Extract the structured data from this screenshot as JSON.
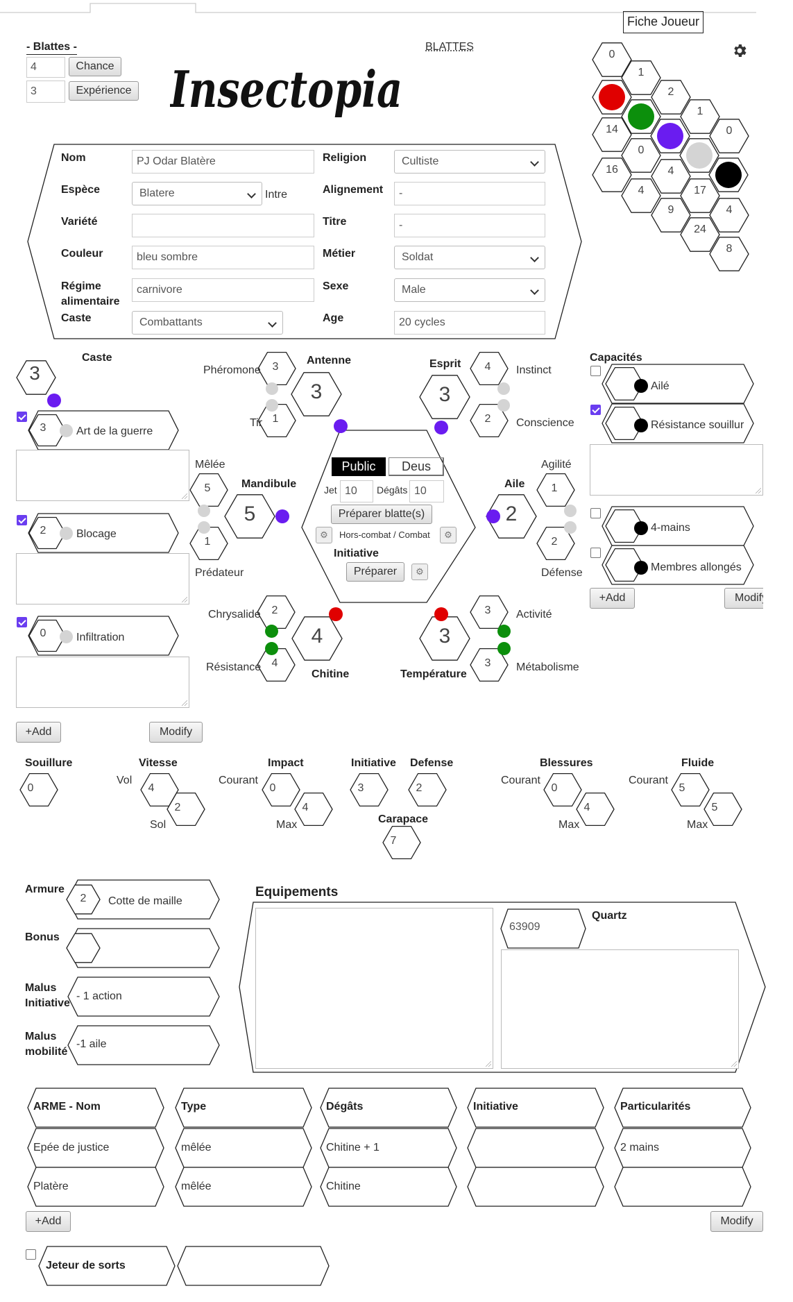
{
  "header": {
    "player_sheet": "Fiche Joueur",
    "blattes_title": "BLATTES",
    "logo_text": "Insectopia",
    "settings_icon": "gear-icon"
  },
  "blattes_box": {
    "title": "- Blattes -",
    "chance_value": "4",
    "chance_label": "Chance",
    "experience_value": "3",
    "experience_label": "Expérience"
  },
  "honeycomb": {
    "numbers": [
      "0",
      "1",
      "2",
      "1",
      "0",
      "14",
      "0",
      "4",
      "17",
      "4",
      "16",
      "4",
      "9",
      "24",
      "8"
    ],
    "dot_colors": {
      "red": "#e00000",
      "green": "#0c8f0c",
      "purple": "#6a1cf0",
      "gray": "#d4d4d4",
      "black": "#000000"
    }
  },
  "identity": {
    "name_label": "Nom",
    "name_value": "PJ Odar Blatère",
    "species_label": "Espèce",
    "species_value": "Blatere",
    "species_suffix": "Intre",
    "variety_label": "Variété",
    "variety_value": "",
    "color_label": "Couleur",
    "color_value": "bleu sombre",
    "diet_label": "Régime alimentaire",
    "diet_value": "carnivore",
    "caste_label": "Caste",
    "caste_value": "Combattants",
    "religion_label": "Religion",
    "religion_value": "Cultiste",
    "alignment_label": "Alignement",
    "alignment_value": "-",
    "title_label": "Titre",
    "title_value": "-",
    "job_label": "Métier",
    "job_value": "Soldat",
    "sex_label": "Sexe",
    "sex_value": "Male",
    "age_label": "Age",
    "age_value": "20 cycles"
  },
  "caste_panel": {
    "label": "Caste",
    "value": "3",
    "skills": [
      {
        "value": "3",
        "name": "Art de la guerre"
      },
      {
        "value": "2",
        "name": "Blocage"
      },
      {
        "value": "0",
        "name": "Infiltration"
      }
    ],
    "add_label": "+Add",
    "modify_label": "Modify"
  },
  "stats": {
    "antenne": {
      "label": "Antenne",
      "value": "3",
      "pheromone_label": "Phéromone",
      "pheromone": "3",
      "tir_label": "Tir",
      "tir": "1"
    },
    "esprit": {
      "label": "Esprit",
      "value": "3",
      "instinct_label": "Instinct",
      "instinct": "4",
      "conscience_label": "Conscience",
      "conscience": "2"
    },
    "mandibule": {
      "label": "Mandibule",
      "value": "5",
      "melee_label": "Mêlée",
      "melee": "5",
      "predateur_label": "Prédateur",
      "predateur": "1"
    },
    "aile": {
      "label": "Aile",
      "value": "2",
      "agilite_label": "Agilité",
      "agilite": "1",
      "defense_label": "Défense",
      "defense": "2"
    },
    "chitine": {
      "label": "Chitine",
      "value": "4",
      "chrysalide_label": "Chrysalide",
      "chrysalide": "2",
      "resistance_label": "Résistance",
      "resistance": "4"
    },
    "temperature": {
      "label": "Température",
      "value": "3",
      "activite_label": "Activité",
      "activite": "3",
      "metabolisme_label": "Métabolisme",
      "metabolisme": "3"
    }
  },
  "center": {
    "tab_public": "Public",
    "tab_deus": "Deus",
    "jet_label": "Jet",
    "jet_value": "10",
    "degats_label": "Dégâts",
    "degats_value": "10",
    "prepare_blattes": "Préparer blatte(s)",
    "combat_label": "Hors-combat / Combat",
    "initiative_label": "Initiative",
    "prepare": "Préparer"
  },
  "capacites": {
    "label": "Capacités",
    "items": [
      {
        "name": "Ailé",
        "checked": false
      },
      {
        "name": "Résistance souillur",
        "checked": true
      },
      {
        "name": "4-mains",
        "checked": false
      },
      {
        "name": "Membres allongés",
        "checked": false
      }
    ],
    "add_label": "+Add",
    "modify_label": "Modify"
  },
  "secondary": {
    "souillure_label": "Souillure",
    "souillure": "0",
    "vitesse_label": "Vitesse",
    "vol_label": "Vol",
    "vol": "4",
    "sol_label": "Sol",
    "sol": "2",
    "impact_label": "Impact",
    "impact_courant_label": "Courant",
    "impact_courant": "0",
    "impact_max_label": "Max",
    "impact_max": "4",
    "initiative_label": "Initiative",
    "initiative": "3",
    "defense_label": "Defense",
    "defense": "2",
    "carapace_label": "Carapace",
    "carapace": "7",
    "blessures_label": "Blessures",
    "blessures_courant_label": "Courant",
    "blessures_courant": "0",
    "blessures_max_label": "Max",
    "blessures_max": "4",
    "fluide_label": "Fluide",
    "fluide_courant_label": "Courant",
    "fluide_courant": "5",
    "fluide_max_label": "Max",
    "fluide_max": "5"
  },
  "armor": {
    "armure_label": "Armure",
    "armure_value": "2",
    "armure_name": "Cotte de maille",
    "bonus_label": "Bonus",
    "malus_init_label": "Malus Initiative",
    "malus_init_value": "- 1 action",
    "malus_mob_label": "Malus mobilité",
    "malus_mob_value": "-1 aile"
  },
  "equipements": {
    "title": "Equipements",
    "quartz_label": "Quartz",
    "quartz_value": "63909"
  },
  "weapons": {
    "headers": [
      "ARME - Nom",
      "Type",
      "Dégâts",
      "Initiative",
      "Particularités"
    ],
    "rows": [
      [
        "Epée de justice",
        "mêlée",
        "Chitine + 1",
        "",
        "2 mains"
      ],
      [
        "Platère",
        "mêlée",
        "Chitine",
        "",
        ""
      ]
    ],
    "add_label": "+Add",
    "modify_label": "Modify"
  },
  "spells": {
    "label": "Jeteur de sorts"
  }
}
